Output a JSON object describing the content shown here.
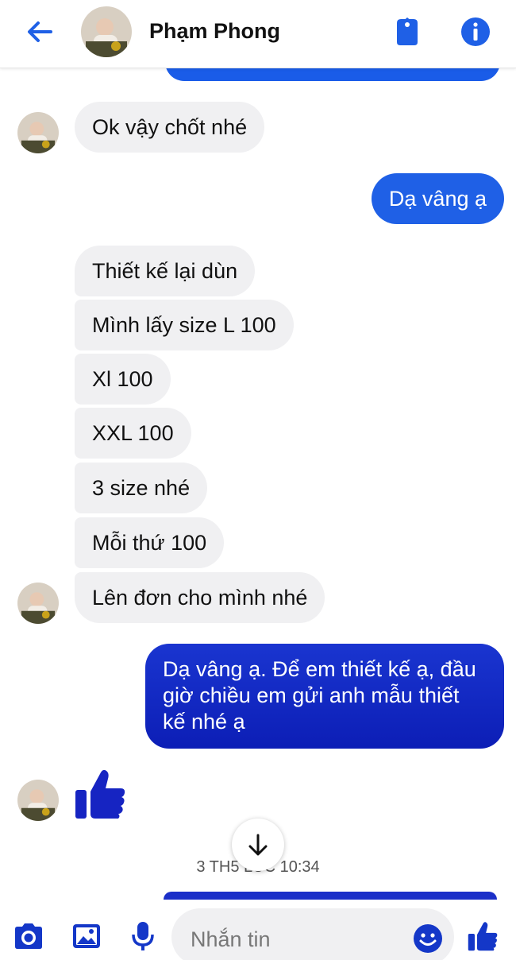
{
  "header": {
    "contact_name": "Phạm Phong"
  },
  "messages": [
    {
      "side": "in",
      "text": "Ok vậy chốt nhé"
    },
    {
      "side": "out",
      "text": "Dạ vâng ạ"
    },
    {
      "side": "in",
      "text": "Thiết kế lại dùn"
    },
    {
      "side": "in",
      "text": "Mình lấy size L 100"
    },
    {
      "side": "in",
      "text": "Xl 100"
    },
    {
      "side": "in",
      "text": "XXL 100"
    },
    {
      "side": "in",
      "text": "3 size nhé"
    },
    {
      "side": "in",
      "text": "Mỗi thứ 100"
    },
    {
      "side": "in",
      "text": "Lên đơn cho mình nhé"
    },
    {
      "side": "out",
      "lines": [
        "Dạ vâng ạ. Để em thiết kế ạ, đầu",
        "giờ chiều em gửi anh mẫu thiết",
        "kế nhé ạ"
      ]
    }
  ],
  "timestamp": "3 TH5 LÚC 10:34",
  "composer": {
    "placeholder": "Nhắn tin"
  },
  "colors": {
    "accent": "#1f60e6",
    "accent_dark": "#0c1eb6",
    "incoming_bubble": "#f0f0f2"
  },
  "icons": [
    "back-arrow-icon",
    "tag-icon",
    "info-icon",
    "thumbs-up-icon",
    "arrow-down-icon",
    "camera-icon",
    "image-icon",
    "microphone-icon",
    "emoji-icon"
  ]
}
